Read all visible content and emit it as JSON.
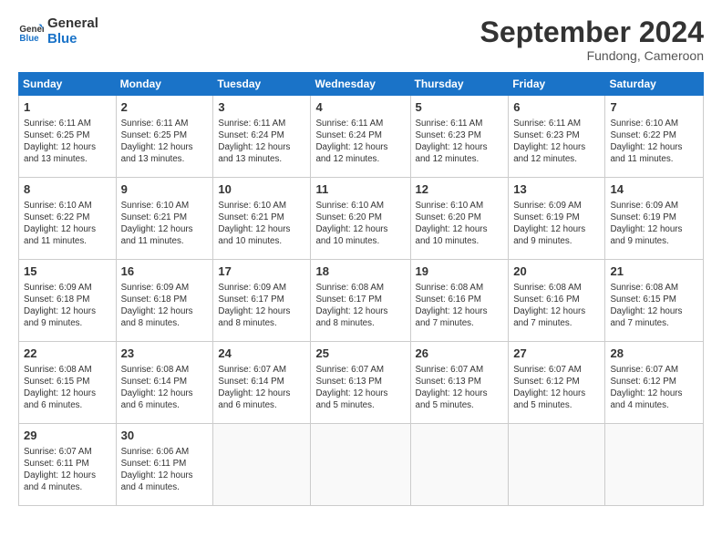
{
  "logo": {
    "line1": "General",
    "line2": "Blue"
  },
  "title": "September 2024",
  "subtitle": "Fundong, Cameroon",
  "days_header": [
    "Sunday",
    "Monday",
    "Tuesday",
    "Wednesday",
    "Thursday",
    "Friday",
    "Saturday"
  ],
  "weeks": [
    [
      {
        "day": "1",
        "info": "Sunrise: 6:11 AM\nSunset: 6:25 PM\nDaylight: 12 hours\nand 13 minutes."
      },
      {
        "day": "2",
        "info": "Sunrise: 6:11 AM\nSunset: 6:25 PM\nDaylight: 12 hours\nand 13 minutes."
      },
      {
        "day": "3",
        "info": "Sunrise: 6:11 AM\nSunset: 6:24 PM\nDaylight: 12 hours\nand 13 minutes."
      },
      {
        "day": "4",
        "info": "Sunrise: 6:11 AM\nSunset: 6:24 PM\nDaylight: 12 hours\nand 12 minutes."
      },
      {
        "day": "5",
        "info": "Sunrise: 6:11 AM\nSunset: 6:23 PM\nDaylight: 12 hours\nand 12 minutes."
      },
      {
        "day": "6",
        "info": "Sunrise: 6:11 AM\nSunset: 6:23 PM\nDaylight: 12 hours\nand 12 minutes."
      },
      {
        "day": "7",
        "info": "Sunrise: 6:10 AM\nSunset: 6:22 PM\nDaylight: 12 hours\nand 11 minutes."
      }
    ],
    [
      {
        "day": "8",
        "info": "Sunrise: 6:10 AM\nSunset: 6:22 PM\nDaylight: 12 hours\nand 11 minutes."
      },
      {
        "day": "9",
        "info": "Sunrise: 6:10 AM\nSunset: 6:21 PM\nDaylight: 12 hours\nand 11 minutes."
      },
      {
        "day": "10",
        "info": "Sunrise: 6:10 AM\nSunset: 6:21 PM\nDaylight: 12 hours\nand 10 minutes."
      },
      {
        "day": "11",
        "info": "Sunrise: 6:10 AM\nSunset: 6:20 PM\nDaylight: 12 hours\nand 10 minutes."
      },
      {
        "day": "12",
        "info": "Sunrise: 6:10 AM\nSunset: 6:20 PM\nDaylight: 12 hours\nand 10 minutes."
      },
      {
        "day": "13",
        "info": "Sunrise: 6:09 AM\nSunset: 6:19 PM\nDaylight: 12 hours\nand 9 minutes."
      },
      {
        "day": "14",
        "info": "Sunrise: 6:09 AM\nSunset: 6:19 PM\nDaylight: 12 hours\nand 9 minutes."
      }
    ],
    [
      {
        "day": "15",
        "info": "Sunrise: 6:09 AM\nSunset: 6:18 PM\nDaylight: 12 hours\nand 9 minutes."
      },
      {
        "day": "16",
        "info": "Sunrise: 6:09 AM\nSunset: 6:18 PM\nDaylight: 12 hours\nand 8 minutes."
      },
      {
        "day": "17",
        "info": "Sunrise: 6:09 AM\nSunset: 6:17 PM\nDaylight: 12 hours\nand 8 minutes."
      },
      {
        "day": "18",
        "info": "Sunrise: 6:08 AM\nSunset: 6:17 PM\nDaylight: 12 hours\nand 8 minutes."
      },
      {
        "day": "19",
        "info": "Sunrise: 6:08 AM\nSunset: 6:16 PM\nDaylight: 12 hours\nand 7 minutes."
      },
      {
        "day": "20",
        "info": "Sunrise: 6:08 AM\nSunset: 6:16 PM\nDaylight: 12 hours\nand 7 minutes."
      },
      {
        "day": "21",
        "info": "Sunrise: 6:08 AM\nSunset: 6:15 PM\nDaylight: 12 hours\nand 7 minutes."
      }
    ],
    [
      {
        "day": "22",
        "info": "Sunrise: 6:08 AM\nSunset: 6:15 PM\nDaylight: 12 hours\nand 6 minutes."
      },
      {
        "day": "23",
        "info": "Sunrise: 6:08 AM\nSunset: 6:14 PM\nDaylight: 12 hours\nand 6 minutes."
      },
      {
        "day": "24",
        "info": "Sunrise: 6:07 AM\nSunset: 6:14 PM\nDaylight: 12 hours\nand 6 minutes."
      },
      {
        "day": "25",
        "info": "Sunrise: 6:07 AM\nSunset: 6:13 PM\nDaylight: 12 hours\nand 5 minutes."
      },
      {
        "day": "26",
        "info": "Sunrise: 6:07 AM\nSunset: 6:13 PM\nDaylight: 12 hours\nand 5 minutes."
      },
      {
        "day": "27",
        "info": "Sunrise: 6:07 AM\nSunset: 6:12 PM\nDaylight: 12 hours\nand 5 minutes."
      },
      {
        "day": "28",
        "info": "Sunrise: 6:07 AM\nSunset: 6:12 PM\nDaylight: 12 hours\nand 4 minutes."
      }
    ],
    [
      {
        "day": "29",
        "info": "Sunrise: 6:07 AM\nSunset: 6:11 PM\nDaylight: 12 hours\nand 4 minutes."
      },
      {
        "day": "30",
        "info": "Sunrise: 6:06 AM\nSunset: 6:11 PM\nDaylight: 12 hours\nand 4 minutes."
      },
      {
        "day": "",
        "info": ""
      },
      {
        "day": "",
        "info": ""
      },
      {
        "day": "",
        "info": ""
      },
      {
        "day": "",
        "info": ""
      },
      {
        "day": "",
        "info": ""
      }
    ]
  ]
}
